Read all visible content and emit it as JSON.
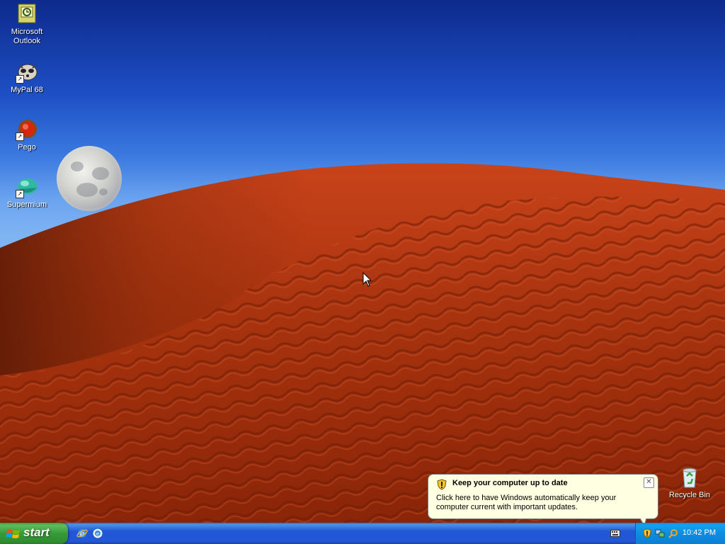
{
  "desktop": {
    "icons": [
      {
        "label": "Microsoft\nOutlook",
        "icon": "outlook-icon"
      },
      {
        "label": "MyPal 68",
        "icon": "mypal-icon"
      },
      {
        "label": "Pego",
        "icon": "pego-icon"
      },
      {
        "label": "Supermium",
        "icon": "supermium-icon"
      },
      {
        "label": "Recycle Bin",
        "icon": "recycle-bin-icon"
      }
    ]
  },
  "balloon": {
    "title": "Keep your computer up to date",
    "body": "Click here to have Windows automatically keep your computer current with important updates.",
    "close": "✕"
  },
  "taskbar": {
    "start_label": "start",
    "quick_launch": [
      "internet-explorer-icon",
      "show-desktop-icon"
    ],
    "tray_icons": [
      "security-shield-icon",
      "network-icon",
      "search-icon"
    ],
    "clock": "10:42 PM"
  },
  "colors": {
    "taskbar": "#2157d7",
    "start_button": "#379b37",
    "tray": "#0f8ce1",
    "balloon_bg": "#ffffe1"
  }
}
